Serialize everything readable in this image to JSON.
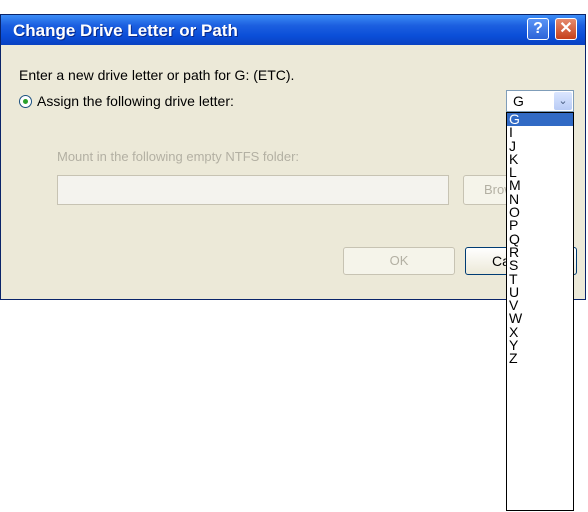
{
  "window": {
    "title": "Change Drive Letter or Path",
    "help_glyph": "?",
    "close_glyph": "✕"
  },
  "dialog": {
    "prompt": "Enter a new drive letter or path for G: (ETC).",
    "assign_label": "Assign the following drive letter:",
    "mount_label": "Mount in the following empty NTFS folder:",
    "path_value": "",
    "browse_label": "Browse...",
    "ok_label": "OK",
    "cancel_label": "Cancel"
  },
  "combo": {
    "selected": "G",
    "arrow_glyph": "⌄"
  },
  "dropdown": {
    "options": [
      "G",
      "I",
      "J",
      "K",
      "L",
      "M",
      "N",
      "O",
      "P",
      "Q",
      "R",
      "S",
      "T",
      "U",
      "V",
      "W",
      "X",
      "Y",
      "Z"
    ]
  },
  "colors": {
    "titlebar": "#0a4ed8",
    "dialog_bg": "#ece9d8",
    "selection": "#316ac5"
  }
}
